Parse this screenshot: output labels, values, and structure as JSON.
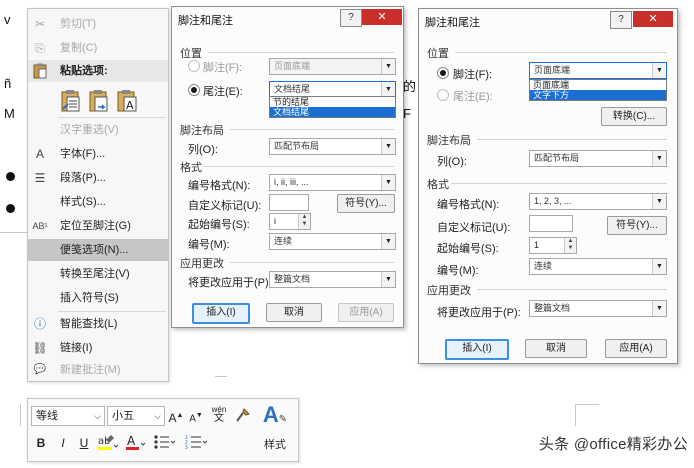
{
  "background": {
    "fragments": [
      "说",
      "的",
      "F"
    ],
    "letters": [
      "v",
      "ñ",
      "M"
    ]
  },
  "context_menu": {
    "items": [
      {
        "name": "cut",
        "icon": "scissors-icon",
        "glyph": "✂",
        "label": "剪切(T)",
        "disabled": true
      },
      {
        "name": "copy",
        "icon": "copy-icon",
        "glyph": "⎘",
        "label": "复制(C)",
        "disabled": true
      },
      {
        "name": "paste-options",
        "icon": "clipboard-icon",
        "glyph": "📋",
        "label": "粘贴选项:",
        "header": true
      },
      {
        "name": "hanzi-reselect",
        "icon": "",
        "glyph": "",
        "label": "汉字重选(V)",
        "disabled": true
      },
      {
        "name": "font",
        "icon": "font-icon",
        "glyph": "A",
        "label": "字体(F)..."
      },
      {
        "name": "paragraph",
        "icon": "paragraph-icon",
        "glyph": "☰",
        "label": "段落(P)..."
      },
      {
        "name": "style",
        "icon": "",
        "glyph": "",
        "label": "样式(S)..."
      },
      {
        "name": "goto-footnote",
        "icon": "footnote-icon",
        "glyph": "AB¹",
        "label": "定位至脚注(G)"
      },
      {
        "name": "note-options",
        "icon": "",
        "glyph": "",
        "label": "便笺选项(N)...",
        "highlight": true
      },
      {
        "name": "convert-to-endnote",
        "icon": "",
        "glyph": "",
        "label": "转换至尾注(V)"
      },
      {
        "name": "insert-symbol",
        "icon": "",
        "glyph": "",
        "label": "插入符号(S)"
      },
      {
        "name": "smart-lookup",
        "icon": "smart-lookup-icon",
        "glyph": "ⓘ",
        "label": "智能查找(L)"
      },
      {
        "name": "link",
        "icon": "link-icon",
        "glyph": "⛓",
        "label": "链接(I)"
      },
      {
        "name": "new-comment",
        "icon": "comment-icon",
        "glyph": "💬",
        "label": "新建批注(M)",
        "disabled": true
      }
    ]
  },
  "dialog_left": {
    "title": "脚注和尾注",
    "section_position": "位置",
    "footnote_label": "脚注(F):",
    "footnote_value": "页面底端",
    "endnote_label": "尾注(E):",
    "endnote_value": "文档结尾",
    "dropdown_options": [
      "节的结尾",
      "文档结尾"
    ],
    "section_layout": "脚注布局",
    "columns_label": "列(O):",
    "columns_value": "匹配节布局",
    "section_format": "格式",
    "number_format_label": "编号格式(N):",
    "number_format_value": "i, ii, iii, ...",
    "custom_mark_label": "自定义标记(U):",
    "symbol_button": "符号(Y)...",
    "start_at_label": "起始编号(S):",
    "start_at_value": "i",
    "numbering_label": "编号(M):",
    "numbering_value": "连续",
    "section_apply": "应用更改",
    "apply_to_label": "将更改应用于(P):",
    "apply_to_value": "整篇文档",
    "insert_button": "插入(I)",
    "cancel_button": "取消",
    "apply_button": "应用(A)"
  },
  "dialog_right": {
    "title": "脚注和尾注",
    "section_position": "位置",
    "footnote_label": "脚注(F):",
    "footnote_value": "页面底端",
    "endnote_label": "尾注(E):",
    "dropdown_options": [
      "页面底端",
      "文字下方"
    ],
    "convert_button": "转换(C)...",
    "section_layout": "脚注布局",
    "columns_label": "列(O):",
    "columns_value": "匹配节布局",
    "section_format": "格式",
    "number_format_label": "编号格式(N):",
    "number_format_value": "1, 2, 3, ...",
    "custom_mark_label": "自定义标记(U):",
    "symbol_button": "符号(Y)...",
    "start_at_label": "起始编号(S):",
    "start_at_value": "1",
    "numbering_label": "编号(M):",
    "numbering_value": "连续",
    "section_apply": "应用更改",
    "apply_to_label": "将更改应用于(P):",
    "apply_to_value": "整篇文档",
    "insert_button": "插入(I)",
    "cancel_button": "取消",
    "apply_button": "应用(A)"
  },
  "mini_toolbar": {
    "font_name": "等线",
    "font_size": "小五",
    "grow_font": "A",
    "shrink_font": "A",
    "phonetic": "wén",
    "bold": "B",
    "italic": "I",
    "underline": "U",
    "styles_label": "样式"
  },
  "watermark": "头条 @office精彩办公",
  "colors": {
    "accent": "#1a6fd1",
    "close": "#c9302c",
    "highlight": "#c6c6c6"
  }
}
